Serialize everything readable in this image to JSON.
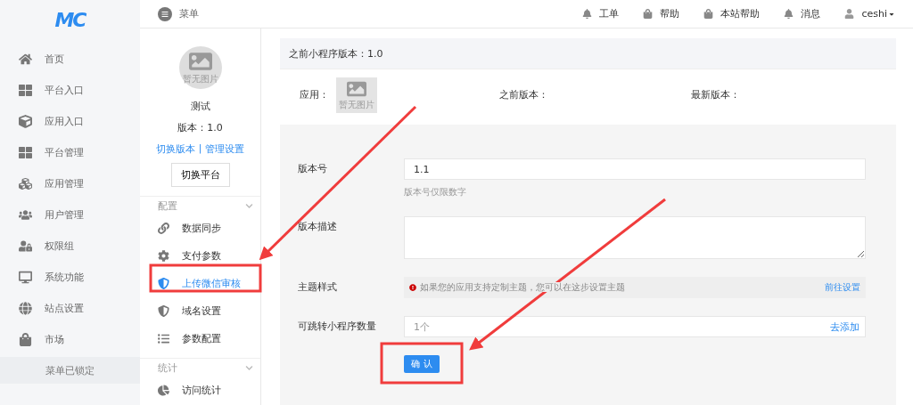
{
  "logo": "MC",
  "nav": [
    {
      "label": "首页"
    },
    {
      "label": "平台入口"
    },
    {
      "label": "应用入口"
    },
    {
      "label": "平台管理"
    },
    {
      "label": "应用管理"
    },
    {
      "label": "用户管理"
    },
    {
      "label": "权限组"
    },
    {
      "label": "系统功能"
    },
    {
      "label": "站点设置"
    },
    {
      "label": "市场"
    }
  ],
  "nav_lock": "菜单已锁定",
  "topbar": {
    "menu": "菜单",
    "links": [
      {
        "label": "工单"
      },
      {
        "label": "帮助"
      },
      {
        "label": "本站帮助"
      },
      {
        "label": "消息"
      }
    ],
    "user": "ceshi"
  },
  "app_card": {
    "image_caption": "暂无图片",
    "name": "测试",
    "version": "版本：1.0",
    "links": [
      "切换版本",
      "管理设置"
    ],
    "separator": "|",
    "button": "切换平台"
  },
  "sections": [
    {
      "title": "配置",
      "expanded": true,
      "items": [
        {
          "label": "数据同步",
          "selected": false
        },
        {
          "label": "支付参数",
          "selected": false
        },
        {
          "label": "上传微信审核",
          "selected": true
        },
        {
          "label": "域名设置",
          "selected": false
        },
        {
          "label": "参数配置",
          "selected": false
        }
      ]
    },
    {
      "title": "统计",
      "expanded": true,
      "items": [
        {
          "label": "访问统计",
          "selected": false
        }
      ]
    }
  ],
  "main": {
    "header": "之前小程序版本：1.0",
    "app_label": "应用：",
    "image_caption": "暂无图片",
    "previous_label": "之前版本：",
    "latest_label": "最新版本：",
    "form": {
      "version_label": "版本号",
      "version_value": "1.1",
      "version_hint": "版本号仅限数字",
      "description_label": "版本描述",
      "theme_label": "主题样式",
      "theme_notice": "如果您的应用支持定制主题，您可以在这步设置主题",
      "theme_link": "前往设置",
      "jump_label": "可跳转小程序数量",
      "jump_value": "1个",
      "jump_link": "去添加",
      "submit": "确 认"
    }
  }
}
